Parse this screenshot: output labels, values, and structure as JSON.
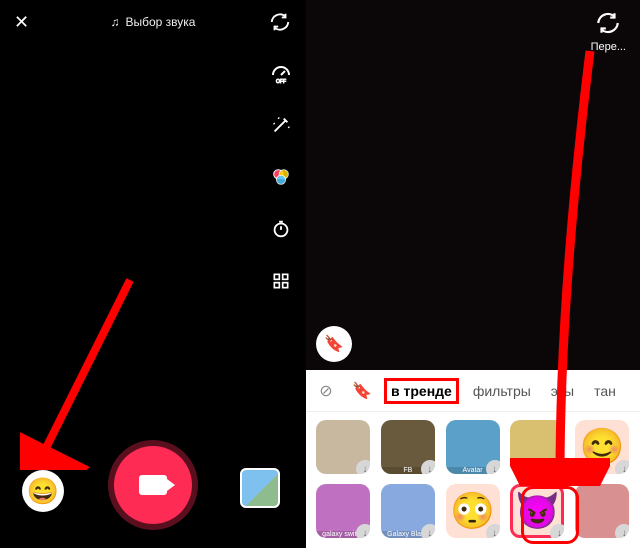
{
  "left": {
    "close": "✕",
    "sound_label": "Выбор звука",
    "tools": [
      "flip",
      "speed",
      "beauty",
      "filters",
      "timer",
      "more"
    ]
  },
  "right": {
    "flip_label": "Пере...",
    "tabs": {
      "none_icon": "⊘",
      "bookmark_icon": "🔖",
      "trending": "в тренде",
      "filters": "фильтры",
      "partial1": "эты",
      "partial2": "тан"
    },
    "effects": [
      {
        "name": "effect-queen",
        "bg": "#c8b8a0"
      },
      {
        "name": "effect-fb",
        "bg": "#6a5a3d",
        "txt": "FB"
      },
      {
        "name": "effect-avatar",
        "bg": "#5aa0c8",
        "txt": "Avatar"
      },
      {
        "name": "effect-glow",
        "bg": "#d8c070"
      },
      {
        "name": "effect-blush-face",
        "bg": "#ffe0d4",
        "emoji": "😊"
      },
      {
        "name": "effect-galaxy-switch",
        "bg": "#c070c0",
        "txt": "galaxy switch"
      },
      {
        "name": "effect-galaxy-blank",
        "bg": "#88a8e0",
        "txt": "Galaxy Blank"
      },
      {
        "name": "effect-flushed",
        "bg": "#ffe0d4",
        "emoji": "😳"
      },
      {
        "name": "effect-devil",
        "bg": "#ffe0d4",
        "emoji": "😈"
      },
      {
        "name": "effect-lipstick",
        "bg": "#d89090"
      }
    ]
  }
}
